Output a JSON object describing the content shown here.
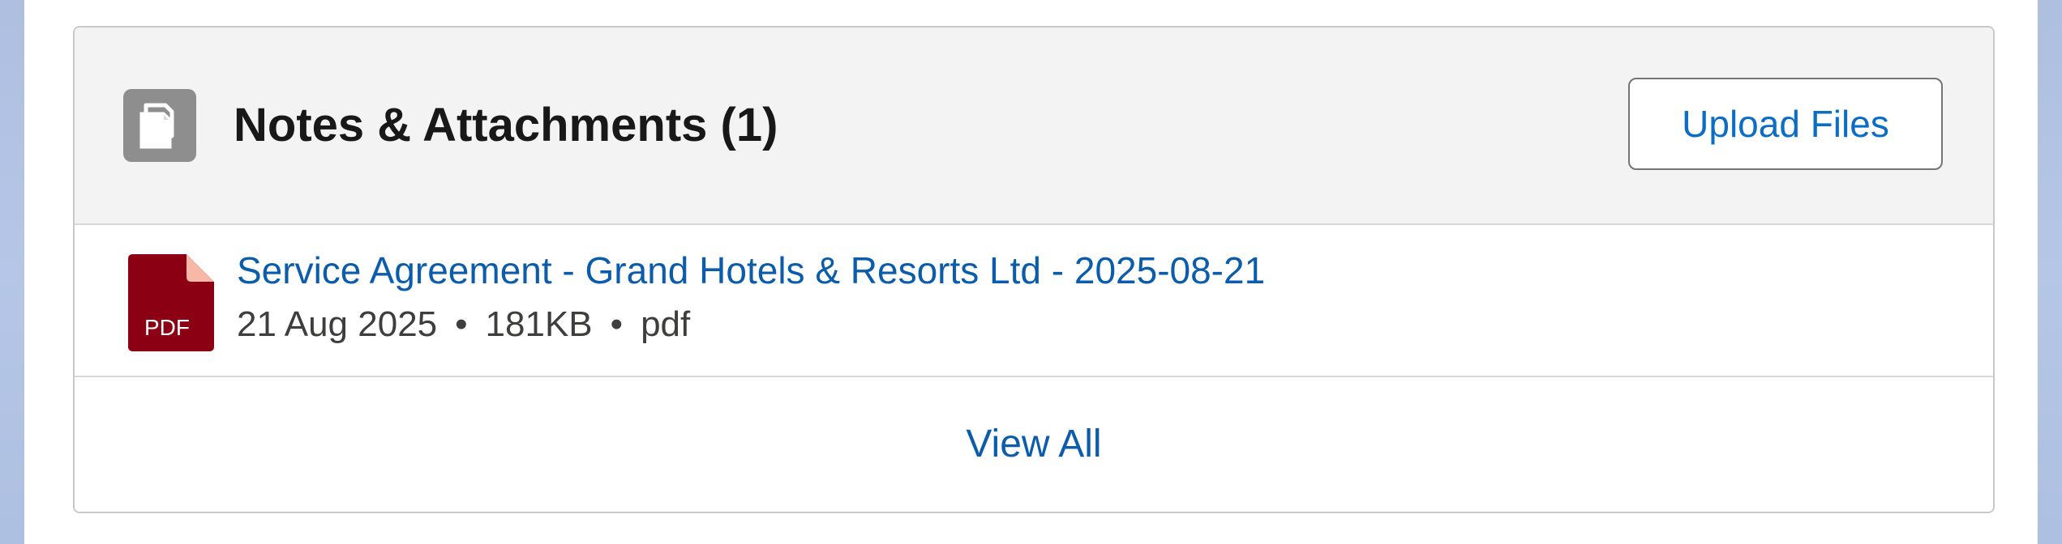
{
  "card": {
    "title": "Notes & Attachments (1)",
    "upload_label": "Upload Files",
    "header_icon": "files-icon"
  },
  "files": [
    {
      "name": "Service Agreement - Grand Hotels & Resorts Ltd - 2025-08-21",
      "date": "21 Aug 2025",
      "size": "181KB",
      "type": "pdf",
      "icon_label": "PDF",
      "separator": "•"
    }
  ],
  "footer": {
    "view_all_label": "View All"
  },
  "colors": {
    "link": "#0b5cab",
    "pdf_red": "#8b0012",
    "header_bg": "#f3f3f3",
    "icon_gray": "#8e8e8e"
  }
}
